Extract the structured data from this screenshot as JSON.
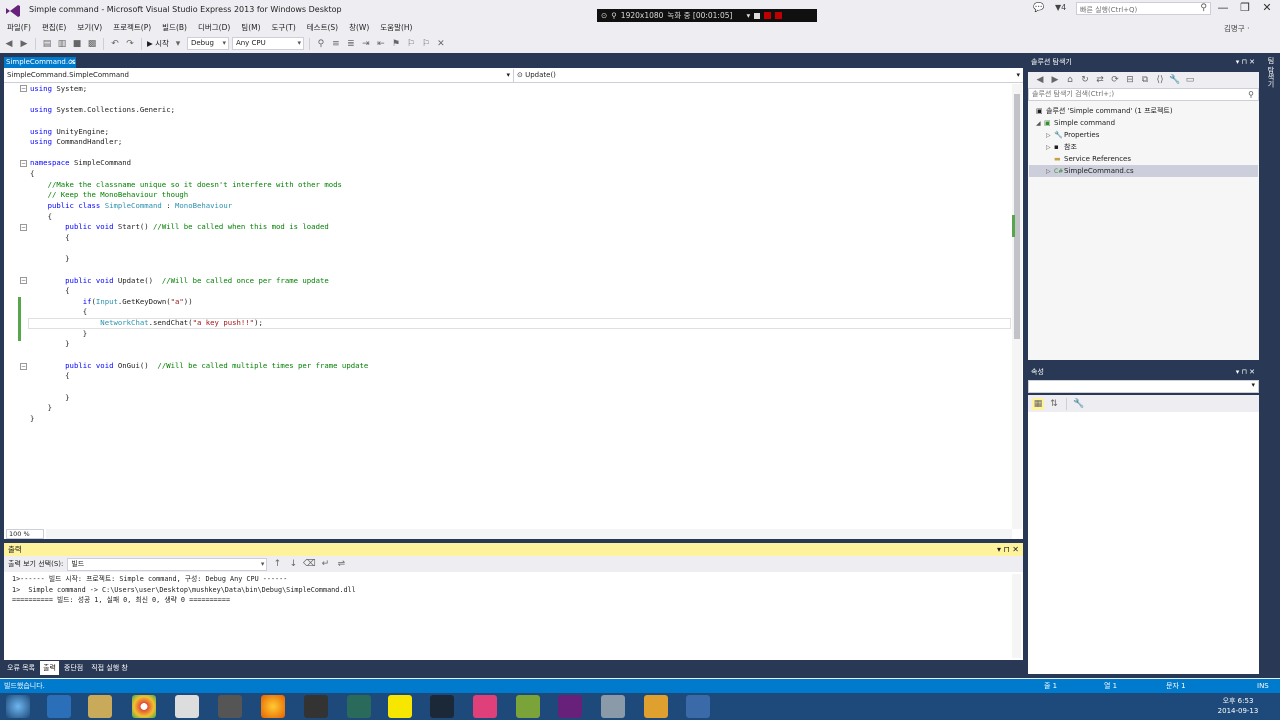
{
  "window": {
    "title": "Simple command - Microsoft Visual Studio Express 2013 for Windows Desktop",
    "notif_count": "4",
    "quick_launch": "빠른 실행(Ctrl+Q)",
    "user": "김명구 ·",
    "minimize": "—",
    "restore": "❐",
    "close": "✕"
  },
  "recorder": {
    "resolution": "1920x1080",
    "status": "녹화 중 [00:01:05]"
  },
  "menu": [
    "파일(F)",
    "편집(E)",
    "보기(V)",
    "프로젝트(P)",
    "빌드(B)",
    "디버그(D)",
    "팀(M)",
    "도구(T)",
    "테스트(S)",
    "창(W)",
    "도움말(H)"
  ],
  "toolbar": {
    "start": "▶ 시작",
    "config": "Debug",
    "platform": "Any CPU"
  },
  "editor": {
    "tab": "SimpleCommand.cs",
    "nav_left": "SimpleCommand.SimpleCommand",
    "nav_right": "Update()",
    "zoom": "100 %"
  },
  "code": [
    [
      [
        "kw",
        "using"
      ],
      [
        "tx",
        " System;"
      ]
    ],
    [],
    [
      [
        "kw",
        "using"
      ],
      [
        "tx",
        " System.Collections.Generic;"
      ]
    ],
    [],
    [
      [
        "kw",
        "using"
      ],
      [
        "tx",
        " UnityEngine;"
      ]
    ],
    [
      [
        "kw",
        "using"
      ],
      [
        "tx",
        " CommandHandler;"
      ]
    ],
    [],
    [
      [
        "kw",
        "namespace"
      ],
      [
        "tx",
        " SimpleCommand"
      ]
    ],
    [
      [
        "tx",
        "{"
      ]
    ],
    [
      [
        "tx",
        "    "
      ],
      [
        "cm",
        "//Make the classname unique so it doesn't interfere with other mods"
      ]
    ],
    [
      [
        "tx",
        "    "
      ],
      [
        "cm",
        "// Keep the MonoBehaviour though"
      ]
    ],
    [
      [
        "tx",
        "    "
      ],
      [
        "kw",
        "public class "
      ],
      [
        "ty",
        "SimpleCommand"
      ],
      [
        "tx",
        " : "
      ],
      [
        "ty",
        "MonoBehaviour"
      ]
    ],
    [
      [
        "tx",
        "    {"
      ]
    ],
    [
      [
        "tx",
        "        "
      ],
      [
        "kw",
        "public void"
      ],
      [
        "tx",
        " Start() "
      ],
      [
        "cm",
        "//Will be called when this mod is loaded"
      ]
    ],
    [
      [
        "tx",
        "        {"
      ]
    ],
    [],
    [
      [
        "tx",
        "        }"
      ]
    ],
    [],
    [
      [
        "tx",
        "        "
      ],
      [
        "kw",
        "public void"
      ],
      [
        "tx",
        " Update()  "
      ],
      [
        "cm",
        "//Will be called once per frame update"
      ]
    ],
    [
      [
        "tx",
        "        {"
      ]
    ],
    [
      [
        "tx",
        "            "
      ],
      [
        "kw",
        "if"
      ],
      [
        "tx",
        "("
      ],
      [
        "ty",
        "Input"
      ],
      [
        "tx",
        ".GetKeyDown("
      ],
      [
        "st",
        "\"a\""
      ],
      [
        "tx",
        "))"
      ]
    ],
    [
      [
        "tx",
        "            {"
      ]
    ],
    [
      [
        "tx",
        "                "
      ],
      [
        "ty",
        "NetworkChat"
      ],
      [
        "tx",
        ".sendChat("
      ],
      [
        "st",
        "\"a key push!!\""
      ],
      [
        "tx",
        ");"
      ]
    ],
    [
      [
        "tx",
        "            }"
      ]
    ],
    [
      [
        "tx",
        "        }"
      ]
    ],
    [],
    [
      [
        "tx",
        "        "
      ],
      [
        "kw",
        "public void"
      ],
      [
        "tx",
        " OnGui()  "
      ],
      [
        "cm",
        "//Will be called multiple times per frame update"
      ]
    ],
    [
      [
        "tx",
        "        {"
      ]
    ],
    [],
    [
      [
        "tx",
        "        }"
      ]
    ],
    [
      [
        "tx",
        "    }"
      ]
    ],
    [
      [
        "tx",
        "}"
      ]
    ]
  ],
  "output": {
    "title": "출력",
    "source_label": "출력 보기 선택(S):",
    "source_value": "빌드",
    "lines": [
      "1>------ 빌드 시작: 프로젝트: Simple command, 구성: Debug Any CPU ------",
      "1>  Simple command -> C:\\Users\\user\\Desktop\\mushkey\\Data\\bin\\Debug\\SimpleCommand.dll",
      "========== 빌드: 성공 1, 실패 0, 최신 0, 생략 0 =========="
    ],
    "controls": "▾ ⊓ ✕"
  },
  "bottom_tabs": [
    "오류 목록",
    "출력",
    "중단점",
    "직접 실행 창"
  ],
  "solution": {
    "title": "솔루션 탐색기",
    "search": "솔루션 탐색기 검색(Ctrl+;)",
    "items": [
      {
        "label": "솔루션 'Simple command' (1 프로젝트)",
        "icon": "▣"
      },
      {
        "label": "Simple command",
        "icon": "▣"
      },
      {
        "label": "Properties",
        "icon": "🔧"
      },
      {
        "label": "참조",
        "icon": "▪"
      },
      {
        "label": "Service References",
        "icon": "▬"
      },
      {
        "label": "SimpleCommand.cs",
        "icon": "C#"
      }
    ]
  },
  "properties": {
    "title": "속성"
  },
  "right_strip": "팀 탐색기",
  "status": {
    "message": "빌드했습니다.",
    "line": "줄 1",
    "col": "열 1",
    "ch": "문자 1",
    "mode": "INS"
  },
  "clock": {
    "time": "오후 6:53",
    "date": "2014-09-13"
  },
  "colors": {
    "accent": "#007acc",
    "frame": "#293955",
    "output_header": "#fff29d"
  }
}
